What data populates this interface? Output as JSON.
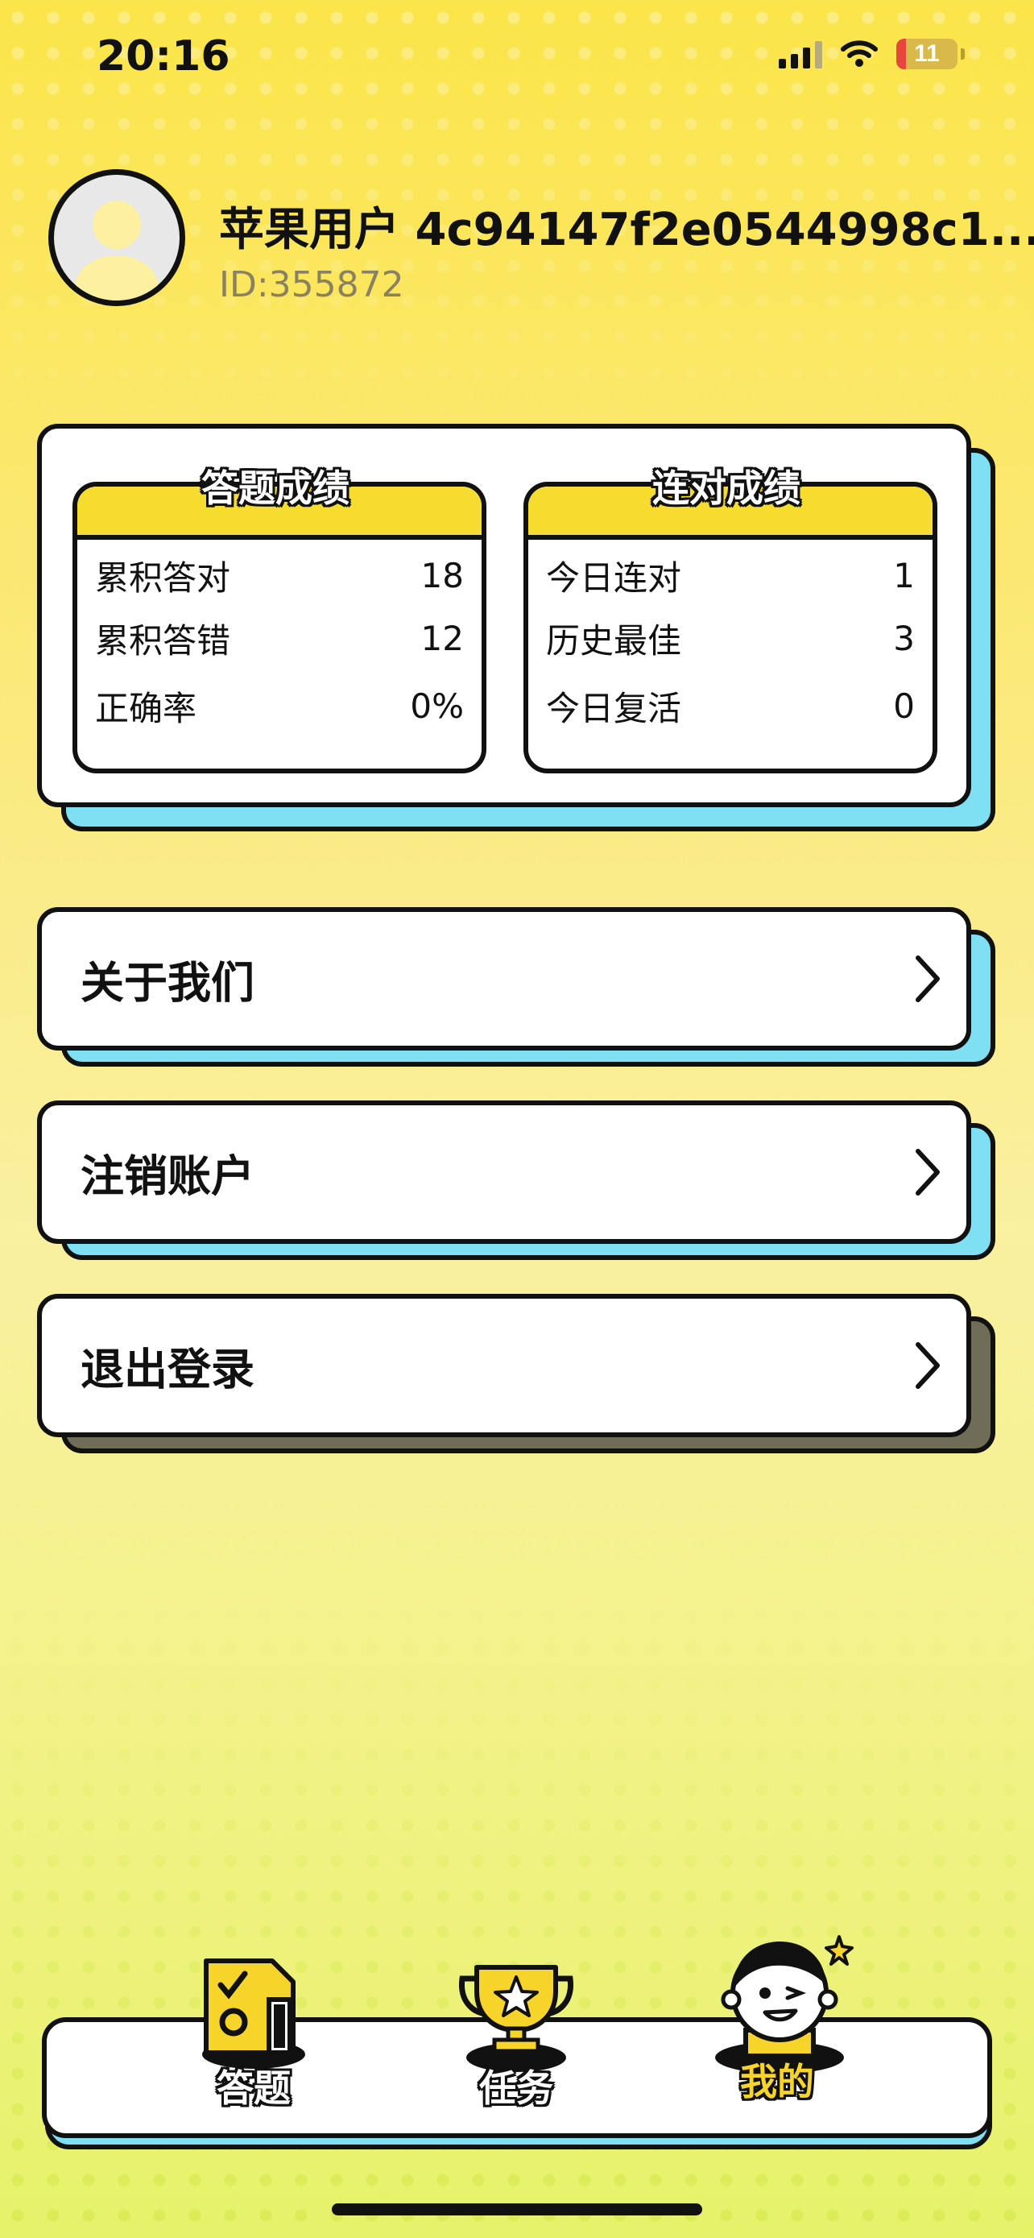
{
  "status_bar": {
    "time": "20:16",
    "battery": "11"
  },
  "profile": {
    "name": "苹果用户 4c94147f2e0544998c1...",
    "id": "ID:355872"
  },
  "stats": {
    "answer": {
      "title": "答题成绩",
      "rows": [
        {
          "label": "累积答对",
          "value": "18"
        },
        {
          "label": "累积答错",
          "value": "12"
        },
        {
          "label": "正确率",
          "value": "0%"
        }
      ]
    },
    "streak": {
      "title": "连对成绩",
      "rows": [
        {
          "label": "今日连对",
          "value": "1"
        },
        {
          "label": "历史最佳",
          "value": "3"
        },
        {
          "label": "今日复活",
          "value": "0"
        }
      ]
    }
  },
  "menu": [
    {
      "label": "关于我们"
    },
    {
      "label": "注销账户"
    },
    {
      "label": "退出登录"
    }
  ],
  "tabs": [
    {
      "label": "答题",
      "icon": "quiz-icon"
    },
    {
      "label": "任务",
      "icon": "trophy-icon"
    },
    {
      "label": "我的",
      "icon": "profile-character-icon",
      "active": true
    }
  ],
  "colors": {
    "accent_yellow": "#f6dc2e",
    "shadow_cyan": "#7fe0f4",
    "outline": "#111111"
  }
}
